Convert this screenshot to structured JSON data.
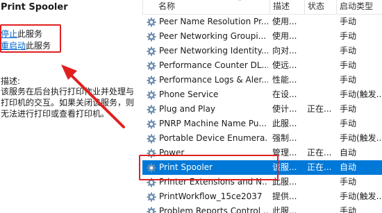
{
  "left": {
    "title": "Print Spooler",
    "stop_link": "停止",
    "stop_suffix": "此服务",
    "restart_link": "重启动",
    "restart_suffix": "此服务",
    "desc_label": "描述:",
    "desc_text": "该服务在后台执行打印作业并处理与打印机的交互。如果关闭该服务，则无法进行打印或查看打印机。"
  },
  "columns": [
    "名称",
    "描述",
    "状态",
    "启动类型"
  ],
  "rows": [
    {
      "name": "Peer Name Resolution Pr...",
      "desc": "使用...",
      "status": "",
      "startup": "手动"
    },
    {
      "name": "Peer Networking Groupi...",
      "desc": "使用...",
      "status": "",
      "startup": "手动"
    },
    {
      "name": "Peer Networking Identity...",
      "desc": "向对...",
      "status": "",
      "startup": "手动"
    },
    {
      "name": "Performance Counter DL...",
      "desc": "使远...",
      "status": "",
      "startup": "手动"
    },
    {
      "name": "Performance Logs & Aler...",
      "desc": "性能...",
      "status": "",
      "startup": "手动"
    },
    {
      "name": "Phone Service",
      "desc": "在设...",
      "status": "",
      "startup": "手动(触发..."
    },
    {
      "name": "Plug and Play",
      "desc": "使计...",
      "status": "正在...",
      "startup": "手动"
    },
    {
      "name": "PNRP Machine Name Pu...",
      "desc": "此服...",
      "status": "",
      "startup": "手动"
    },
    {
      "name": "Portable Device Enumera...",
      "desc": "强制...",
      "status": "",
      "startup": "手动(触发..."
    },
    {
      "name": "Power",
      "desc": "管理...",
      "status": "正在...",
      "startup": "自动"
    },
    {
      "name": "Print Spooler",
      "desc": "该服...",
      "status": "正在...",
      "startup": "自动"
    },
    {
      "name": "Printer Extensions and N...",
      "desc": "此服...",
      "status": "",
      "startup": "手动"
    },
    {
      "name": "PrintWorkflow_15ce2037",
      "desc": "提供...",
      "status": "",
      "startup": "手动(触发..."
    },
    {
      "name": "Problem Reports Control ...",
      "desc": "此服...",
      "status": "",
      "startup": "手动"
    }
  ],
  "selected_row": "Print Spooler",
  "colors": {
    "highlight_box": "#e02020",
    "selection": "#0078d7",
    "link": "#0066cc"
  },
  "icons": [
    "gear-icon",
    "sort-arrow-icon"
  ]
}
